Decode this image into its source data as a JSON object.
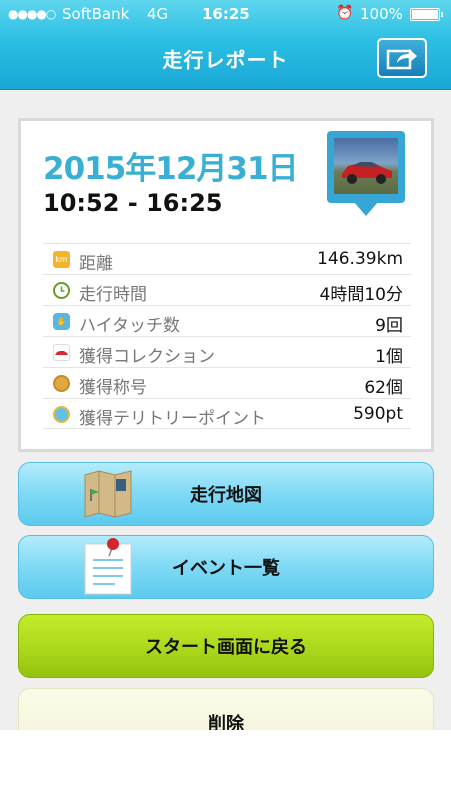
{
  "status_bar": {
    "signal": "●●●●○",
    "carrier": "SoftBank",
    "network": "4G",
    "time": "16:25",
    "alarm_icon": "alarm-clock-icon",
    "battery_percent": "100%"
  },
  "header": {
    "title": "走行レポート",
    "share_icon": "share-export-icon"
  },
  "report": {
    "date": "2015年12月31日",
    "time_range": "10:52 - 16:25",
    "stats": [
      {
        "icon": "km-icon",
        "label": "距離",
        "value": "146.39km"
      },
      {
        "icon": "clock-icon",
        "label": "走行時間",
        "value": "4時間10分"
      },
      {
        "icon": "hand-icon",
        "label": "ハイタッチ数",
        "value": "9回"
      },
      {
        "icon": "car-icon",
        "label": "獲得コレクション",
        "value": "1個"
      },
      {
        "icon": "medal-icon",
        "label": "獲得称号",
        "value": "62個"
      },
      {
        "icon": "territory-point-icon",
        "label": "獲得テリトリーポイント",
        "value": "590pt"
      }
    ]
  },
  "buttons": {
    "map": "走行地図",
    "events": "イベント一覧",
    "back_to_start": "スタート画面に戻る",
    "delete": "削除"
  },
  "colors": {
    "header": "#2bbfe3",
    "date": "#3aafd4",
    "button_blue": "#7fd9f5",
    "button_green": "#a9d51a",
    "button_cream": "#f6f6df"
  }
}
